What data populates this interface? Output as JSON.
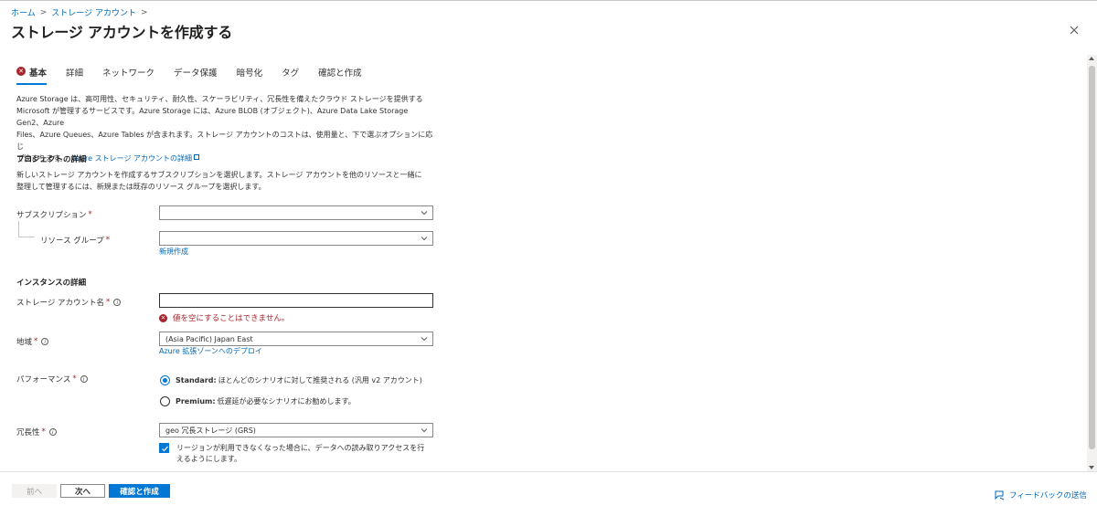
{
  "breadcrumb": {
    "home": "ホーム",
    "sep": ">",
    "storage": "ストレージ アカウント"
  },
  "header": {
    "title": "ストレージ アカウントを作成する",
    "ellipsis": "···"
  },
  "tabs": [
    {
      "label": "基本",
      "state": "error"
    },
    {
      "label": "詳細"
    },
    {
      "label": "ネットワーク"
    },
    {
      "label": "データ保護"
    },
    {
      "label": "暗号化"
    },
    {
      "label": "タグ"
    },
    {
      "label": "確認と作成"
    }
  ],
  "intro": {
    "line1": "Azure Storage は、高可用性、セキュリティ、耐久性、スケーラビリティ、冗長性を備えたクラウド ストレージを提供する",
    "line2": "Microsoft が管理するサービスです。Azure Storage には、Azure BLOB (オブジェクト)、Azure Data Lake Storage Gen2、Azure",
    "line3": "Files、Azure Queues、Azure Tables が含まれます。ストレージ アカウントのコストは、使用量と、下で選ぶオプションに応じ",
    "line4": "て決まります。",
    "link": "Azure ストレージ アカウントの詳細"
  },
  "project": {
    "title": "プロジェクトの詳細",
    "desc1": "新しいストレージ アカウントを作成するサブスクリプションを選択します。ストレージ アカウントを他のリソースと一緒に",
    "desc2": "整理して管理するには、新規または既存のリソース グループを選択します。",
    "subscription_label": "サブスクリプション",
    "subscription_value": "",
    "resource_group_label": "リソース グループ",
    "resource_group_value": "",
    "create_new": "新規作成",
    "required": "*"
  },
  "instance": {
    "title": "インスタンスの詳細",
    "name_label": "ストレージ アカウント名",
    "name_value": "",
    "name_error": "値を空にすることはできません。",
    "region_label": "地域",
    "region_value": "(Asia Pacific) Japan East",
    "edge_link": "Azure 拡張ゾーンへのデプロイ",
    "performance_label": "パフォーマンス",
    "perf_standard_bold": "Standard:",
    "perf_standard_text": "ほとんどのシナリオに対して推奨される (汎用 v2 アカウント)",
    "perf_premium_bold": "Premium:",
    "perf_premium_text": "低遅延が必要なシナリオにお勧めします。",
    "redundancy_label": "冗長性",
    "redundancy_value": "geo 冗長ストレージ (GRS)",
    "read_access_line1": "リージョンが利用できなくなった場合に、データへの読み取りアクセスを行",
    "read_access_line2": "えるようにします。"
  },
  "footer": {
    "prev": "前へ",
    "next": "次へ",
    "review": "確認と作成",
    "feedback": "フィードバックの送信"
  },
  "colors": {
    "accent": "#0078d4",
    "error": "#a4262c",
    "link": "#0067b8"
  }
}
